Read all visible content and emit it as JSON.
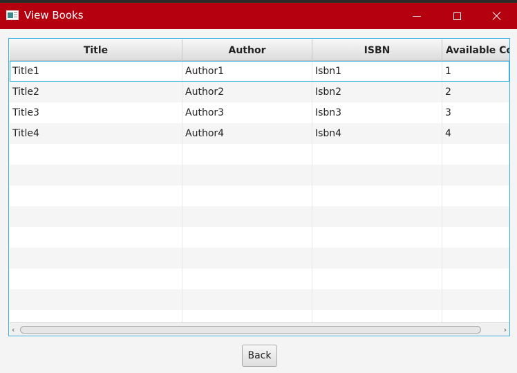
{
  "window": {
    "title": "View Books",
    "title_color": "#b4000f",
    "icons": {
      "app": "app-window-icon",
      "minimize": "minimize-icon",
      "maximize": "maximize-icon",
      "close": "close-icon"
    }
  },
  "table": {
    "columns": [
      "Title",
      "Author",
      "ISBN",
      "Available Co"
    ],
    "rows": [
      [
        "Title1",
        "Author1",
        "Isbn1",
        "1"
      ],
      [
        "Title2",
        "Author2",
        "Isbn2",
        "2"
      ],
      [
        "Title3",
        "Author3",
        "Isbn3",
        "3"
      ],
      [
        "Title4",
        "Author4",
        "Isbn4",
        "4"
      ]
    ],
    "empty_rows": 9,
    "selected_row": 0,
    "accent_color": "#3ab0e0"
  },
  "scrollbar": {
    "left_arrow": "‹",
    "right_arrow": "›"
  },
  "actions": {
    "back_label": "Back"
  }
}
